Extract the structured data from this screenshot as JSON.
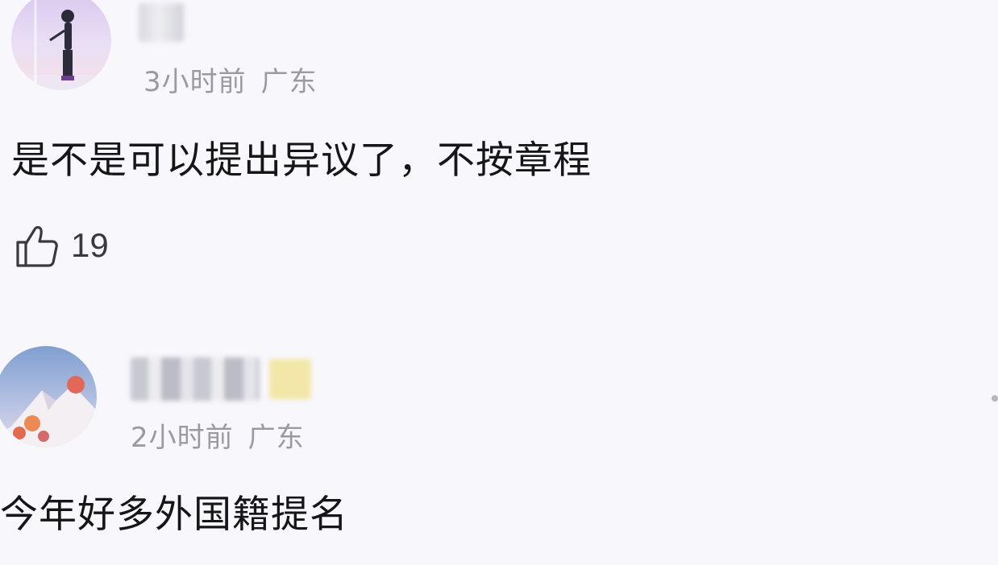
{
  "comments": [
    {
      "avatar_icon": "avatar-icon",
      "meta": {
        "time": "3小时前",
        "location": "广东"
      },
      "text": "是不是可以提出异议了，不按章程",
      "likes": {
        "icon": "thumbs-up-icon",
        "count": "19"
      }
    },
    {
      "avatar_icon": "avatar-icon",
      "meta": {
        "time": "2小时前",
        "location": "广东"
      },
      "text": "今年好多外国籍提名"
    }
  ]
}
